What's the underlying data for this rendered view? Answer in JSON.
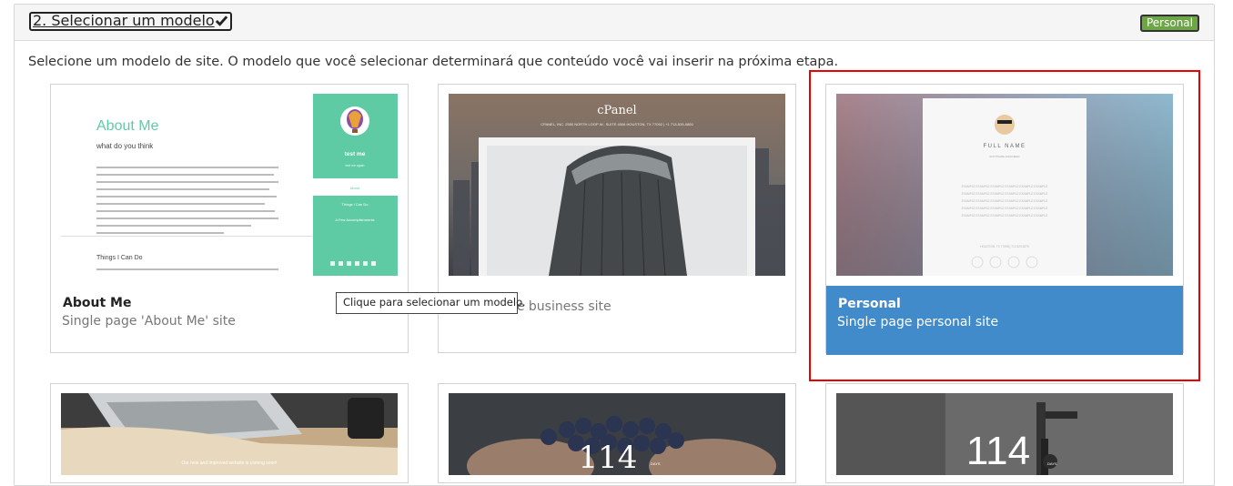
{
  "step": {
    "title": "2. Selecionar um modelo",
    "badge": "Personal"
  },
  "instruction": "Selecione um modelo de site. O modelo que você selecionar determinará que conteúdo você vai inserir na próxima etapa.",
  "tooltip": "Clique para selecionar um modelo.",
  "accent_color": "#428bca",
  "highlight_color": "#e00000",
  "templates": [
    {
      "name": "About Me",
      "description": "Single page 'About Me' site",
      "selected": false,
      "preview": {
        "heading": "About Me",
        "subheading": "what do you think",
        "section": "Things I Can Do",
        "side_name": "test me",
        "side_sub": "test me again",
        "side_link": "About",
        "side_items": [
          "Things I Can Do",
          "A Few Accomplishments"
        ]
      }
    },
    {
      "name": "",
      "description": "Single page business site",
      "selected": false,
      "preview": {
        "brand": "cPanel",
        "address": "CPANEL, INC. 2550 NORTH LOOP W., SUITE 4006 HOUSTON, TX 77092 | +1 713-529-0800"
      }
    },
    {
      "name": "Personal",
      "description": "Single page personal site",
      "selected": true,
      "preview": {
        "name": "FULL NAME",
        "title": "SOFTWARE ENGINEER",
        "sample": "EXAMPLE EXAMPLE EXAMPLE EXAMPLE EXAMPLE EXAMPLE",
        "location": "HOUSTON, TX 77098 | 713.529.2879"
      }
    },
    {
      "name": "",
      "description": "",
      "selected": false,
      "preview": {
        "banner": "Our new and improved website is coming soon!"
      }
    },
    {
      "name": "",
      "description": "",
      "selected": false,
      "preview": {
        "count": "114",
        "unit": "DAYS"
      }
    },
    {
      "name": "",
      "description": "",
      "selected": false,
      "preview": {
        "count": "114",
        "unit": "DAYS"
      }
    }
  ]
}
